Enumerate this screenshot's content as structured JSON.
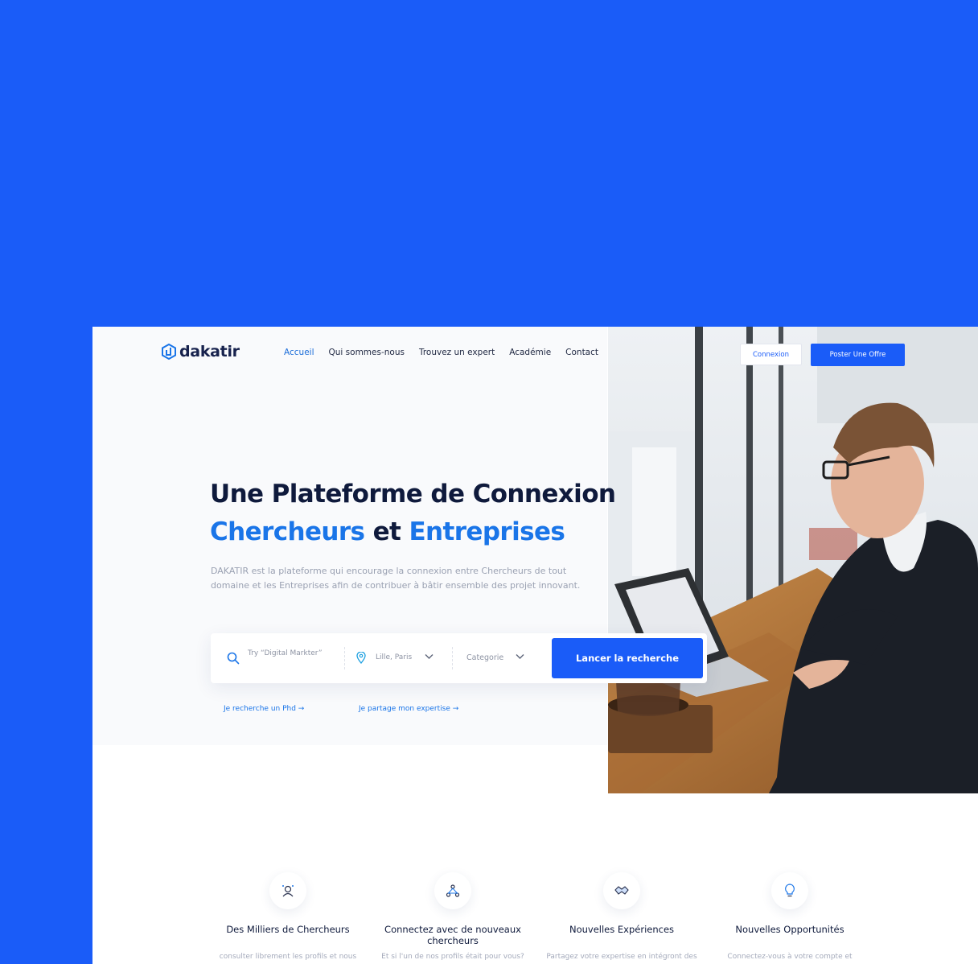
{
  "brand": {
    "name": "dakatir"
  },
  "nav": {
    "items": [
      {
        "label": "Accueil",
        "active": true
      },
      {
        "label": "Qui sommes-nous",
        "active": false
      },
      {
        "label": "Trouvez un expert",
        "active": false
      },
      {
        "label": "Académie",
        "active": false
      },
      {
        "label": "Contact",
        "active": false
      }
    ],
    "login_label": "Connexion",
    "post_label": "Poster Une Offre"
  },
  "hero": {
    "line1": "Une Plateforme de Connexion",
    "line2_a": "Chercheurs",
    "line2_b": " et ",
    "line2_c": "Entreprises",
    "description": "DAKATIR est la plateforme qui encourage la connexion entre Chercheurs de tout domaine et les Entreprises afin de contribuer à bâtir ensemble des projet innovant."
  },
  "search": {
    "placeholder": "Try “Digital Markter”",
    "location_value": "Lille, Paris",
    "category_value": "Categorie",
    "button_label": "Lancer la recherche"
  },
  "links": {
    "phd": "Je recherche un Phd →",
    "expertise": "Je partage mon expertise →"
  },
  "features": [
    {
      "title": "Des Milliers de Chercheurs",
      "desc": "consulter librement les profils et nous",
      "icon": "researchers-icon"
    },
    {
      "title": "Connectez avec de nouveaux chercheurs",
      "desc": "Et si l'un de nos profils était pour vous?",
      "icon": "network-icon"
    },
    {
      "title": "Nouvelles Expériences",
      "desc": "Partagez votre expertise en intégront des",
      "icon": "handshake-icon"
    },
    {
      "title": "Nouvelles Opportunités",
      "desc": "Connectez-vous à votre compte et",
      "icon": "lightbulb-icon"
    }
  ],
  "colors": {
    "accent": "#1a5cf8",
    "link": "#1a75e8",
    "heading": "#0f1a3c"
  }
}
